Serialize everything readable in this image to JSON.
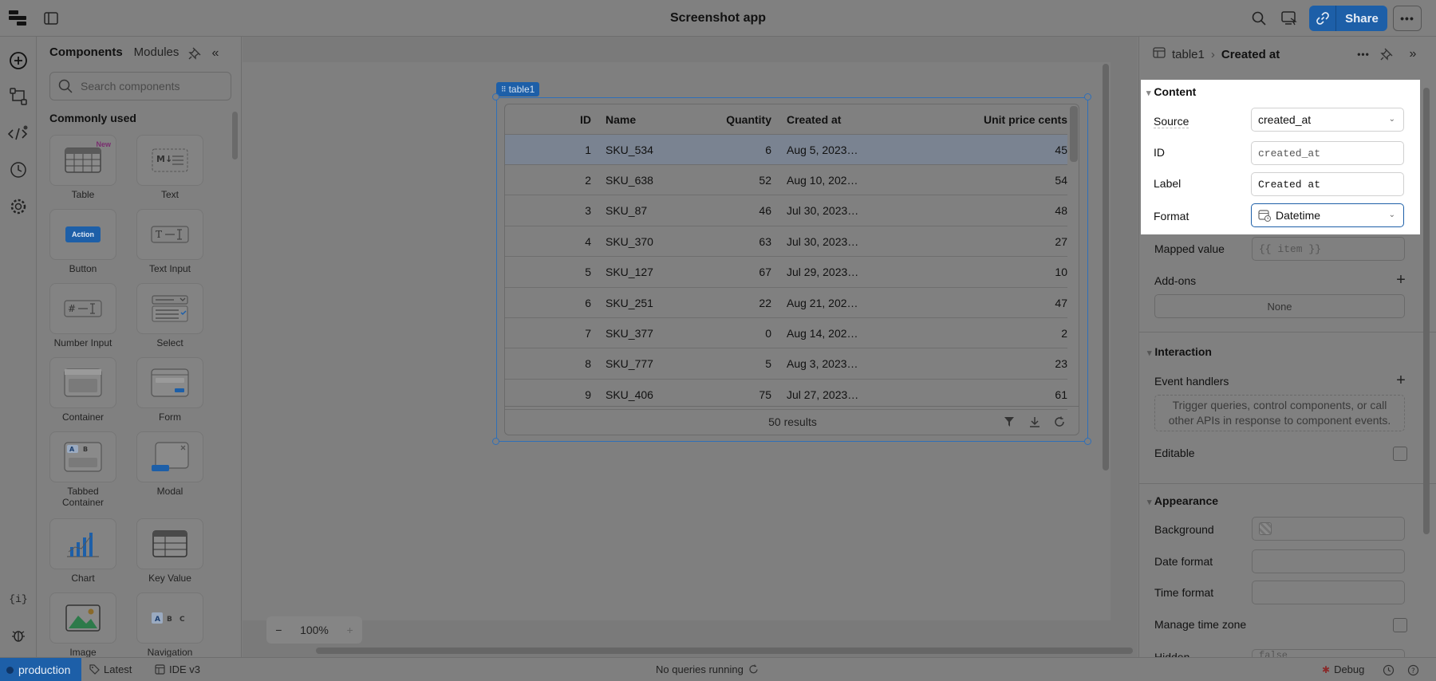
{
  "app_title": "Screenshot app",
  "header": {
    "share_label": "Share"
  },
  "components_panel": {
    "tabs": [
      "Components",
      "Modules"
    ],
    "search_placeholder": "Search components",
    "section_title": "Commonly used",
    "new_badge": "New",
    "tiles": [
      {
        "label": "Table",
        "icon": "table-icon"
      },
      {
        "label": "Text",
        "icon": "markdown-icon"
      },
      {
        "label": "Button",
        "icon": "button-icon",
        "preview_text": "Action"
      },
      {
        "label": "Text Input",
        "icon": "text-input-icon"
      },
      {
        "label": "Number Input",
        "icon": "number-input-icon"
      },
      {
        "label": "Select",
        "icon": "select-icon"
      },
      {
        "label": "Container",
        "icon": "container-icon"
      },
      {
        "label": "Form",
        "icon": "form-icon"
      },
      {
        "label": "Tabbed Container",
        "icon": "tabbed-container-icon"
      },
      {
        "label": "Modal",
        "icon": "modal-icon"
      },
      {
        "label": "Chart",
        "icon": "chart-icon"
      },
      {
        "label": "Key Value",
        "icon": "key-value-icon"
      },
      {
        "label": "Image",
        "icon": "image-icon"
      },
      {
        "label": "Navigation",
        "icon": "navigation-icon"
      }
    ]
  },
  "canvas": {
    "zoom_level": "100%",
    "table_tag": "table1",
    "table": {
      "columns": [
        "ID",
        "Name",
        "Quantity",
        "Created at",
        "Unit price cents"
      ],
      "rows": [
        [
          "1",
          "SKU_534",
          "6",
          "Aug 5, 2023…",
          "45"
        ],
        [
          "2",
          "SKU_638",
          "52",
          "Aug 10, 202…",
          "54"
        ],
        [
          "3",
          "SKU_87",
          "46",
          "Jul 30, 2023…",
          "48"
        ],
        [
          "4",
          "SKU_370",
          "63",
          "Jul 30, 2023…",
          "27"
        ],
        [
          "5",
          "SKU_127",
          "67",
          "Jul 29, 2023…",
          "10"
        ],
        [
          "6",
          "SKU_251",
          "22",
          "Aug 21, 202…",
          "47"
        ],
        [
          "7",
          "SKU_377",
          "0",
          "Aug 14, 202…",
          "2"
        ],
        [
          "8",
          "SKU_777",
          "5",
          "Aug 3, 2023…",
          "23"
        ],
        [
          "9",
          "SKU_406",
          "75",
          "Jul 27, 2023…",
          "61"
        ]
      ],
      "footer": "50 results"
    }
  },
  "inspector": {
    "breadcrumb_parent": "table1",
    "breadcrumb_sep": "›",
    "breadcrumb_current": "Created at",
    "content": {
      "title": "Content",
      "source_label": "Source",
      "source_value": "created_at",
      "id_label": "ID",
      "id_value": "created_at",
      "label_label": "Label",
      "label_value": "Created at",
      "format_label": "Format",
      "format_value": "Datetime"
    },
    "mapped_value_label": "Mapped value",
    "mapped_value": "{{ item }}",
    "addons_label": "Add-ons",
    "addons_value": "None",
    "interaction": {
      "title": "Interaction",
      "event_handlers": "Event handlers",
      "event_help": "Trigger queries, control components, or call other APIs in response to component events.",
      "editable": "Editable"
    },
    "appearance": {
      "title": "Appearance",
      "background": "Background",
      "date_format": "Date format",
      "time_format": "Time format",
      "manage_tz": "Manage time zone",
      "hidden": "Hidden",
      "hidden_value": "false"
    }
  },
  "statusbar": {
    "env": "production",
    "version": "Latest",
    "ide": "IDE v3",
    "queries": "No queries running",
    "debug": "Debug"
  }
}
